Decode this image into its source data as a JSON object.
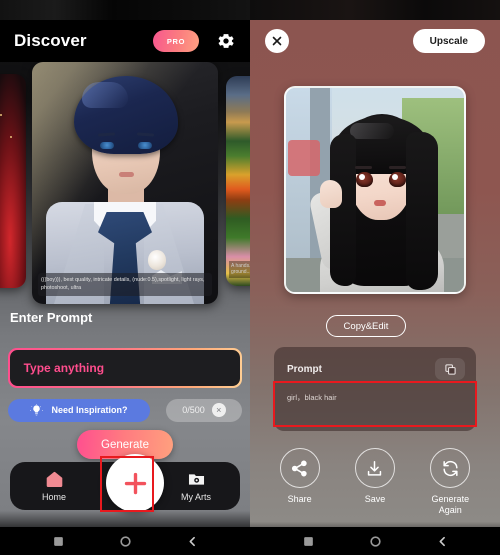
{
  "left": {
    "header": {
      "title": "Discover",
      "pro_label": "PRO",
      "settings_icon": "gear-icon"
    },
    "carousel": {
      "main_card": {
        "caption": "(((boy))), best quality, intricate details, (nude:0.5),spotlight, light rays, photoshoot, ultra",
        "subject": "anime boy in white suit with navy cravat"
      },
      "side_card_right_caption": "A hands... ground..."
    },
    "prompt_section": {
      "label": "Enter Prompt",
      "input_placeholder": "Type anything",
      "input_value": "",
      "inspiration_label": "Need Inspiration?",
      "inspiration_icon": "lightbulb-icon",
      "char_count": "0/500",
      "clear_glyph": "×"
    },
    "generate_label": "Generate",
    "nav": {
      "items": [
        {
          "label": "Home",
          "icon": "home-icon"
        },
        {
          "label": "My Arts",
          "icon": "folder-photo-icon"
        }
      ],
      "fab_icon": "plus-icon"
    }
  },
  "right": {
    "header": {
      "close_icon": "close-icon",
      "upscale_label": "Upscale"
    },
    "result": {
      "subject": "anime girl with long black hair in gray sweater"
    },
    "copy_edit_label": "Copy&Edit",
    "prompt_card": {
      "title": "Prompt",
      "copy_icon": "copy-icon",
      "value": "girl，black hair"
    },
    "actions": [
      {
        "label": "Share",
        "icon": "share-icon"
      },
      {
        "label": "Save",
        "icon": "download-icon"
      },
      {
        "label": "Generate\nAgain",
        "icon": "refresh-icon"
      }
    ]
  },
  "system_nav": {
    "recents_icon": "square-icon",
    "home_icon": "circle-icon",
    "back_icon": "back-chevron-icon"
  },
  "annotations": {
    "highlight_color": "#e8191e",
    "boxes": [
      "fab-plus-button",
      "prompt-value-field"
    ]
  },
  "colors": {
    "accent_pink": "#ff4d8d",
    "accent_orange": "#ffa07e",
    "inspiration_blue": "#5b7ae0",
    "right_panel_bg": "#8c5550"
  }
}
